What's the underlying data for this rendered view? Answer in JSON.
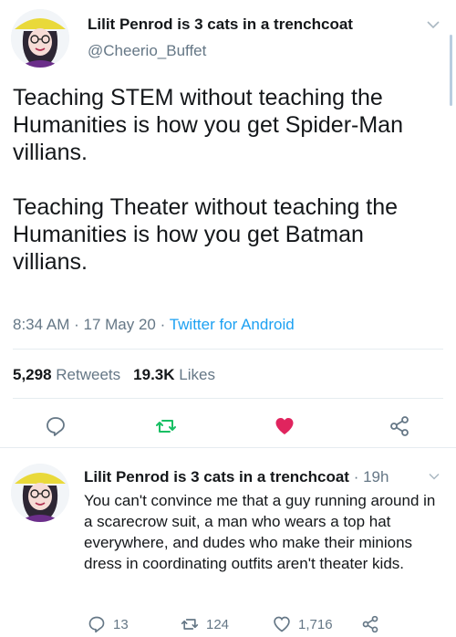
{
  "main_tweet": {
    "display_name": "Lilit Penrod is 3 cats in a trenchcoat",
    "handle": "@Cheerio_Buffet",
    "text": "Teaching STEM without teaching the Humanities is how you get Spider-Man villians.\n\nTeaching Theater without teaching the Humanities is how you get Batman villians.",
    "time": "8:34 AM",
    "date": "17 May 20",
    "source": "Twitter for Android",
    "separator": " · ",
    "retweets_count": "5,298",
    "retweets_label": "Retweets",
    "likes_count": "19.3K",
    "likes_label": "Likes"
  },
  "reply_tweet": {
    "display_name": "Lilit Penrod is 3 cats in a trenchcoat",
    "time": "19h",
    "separator": " · ",
    "text": "You can't convince me that a guy running around in a scarecrow suit, a man who wears a top hat everywhere, and dudes who make their minions dress in coordinating outfits aren't theater kids.",
    "reply_count": "13",
    "retweet_count": "124",
    "like_count": "1,716"
  },
  "icons": {
    "reply": "reply-icon",
    "retweet": "retweet-icon",
    "like": "heart-icon",
    "share": "share-icon",
    "menu": "chevron-down-icon"
  },
  "colors": {
    "text": "#14171a",
    "muted": "#657786",
    "link": "#1da1f2",
    "retweet": "#17bf63",
    "like": "#e0245e",
    "avatar_hat": "#e9d93a"
  }
}
